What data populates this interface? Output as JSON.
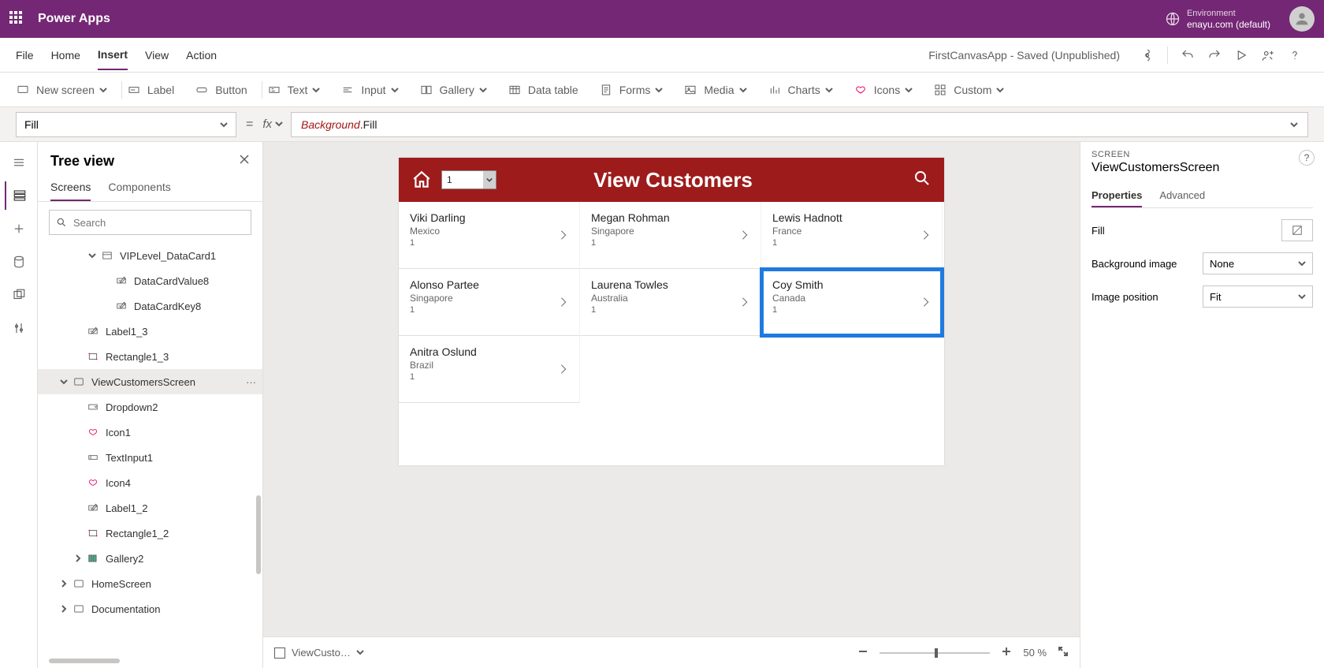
{
  "topbar": {
    "brand": "Power Apps",
    "env_label": "Environment",
    "env_value": "enayu.com (default)"
  },
  "menu": {
    "items": [
      "File",
      "Home",
      "Insert",
      "View",
      "Action"
    ],
    "active": "Insert",
    "app_status": "FirstCanvasApp - Saved (Unpublished)"
  },
  "ribbon": {
    "items": [
      {
        "label": "New screen",
        "icon": "screen-icon",
        "chev": true
      },
      {
        "label": "Label",
        "icon": "label-icon"
      },
      {
        "label": "Button",
        "icon": "button-icon"
      },
      {
        "label": "Text",
        "icon": "text-icon",
        "chev": true
      },
      {
        "label": "Input",
        "icon": "input-icon",
        "chev": true
      },
      {
        "label": "Gallery",
        "icon": "gallery-icon",
        "chev": true
      },
      {
        "label": "Data table",
        "icon": "datatable-icon"
      },
      {
        "label": "Forms",
        "icon": "forms-icon",
        "chev": true
      },
      {
        "label": "Media",
        "icon": "media-icon",
        "chev": true
      },
      {
        "label": "Charts",
        "icon": "charts-icon",
        "chev": true
      },
      {
        "label": "Icons",
        "icon": "icons-icon",
        "chev": true
      },
      {
        "label": "Custom",
        "icon": "custom-icon",
        "chev": true
      }
    ]
  },
  "formulabar": {
    "prop": "Fill",
    "formula_tok1": "Background",
    "formula_tok2": ".Fill"
  },
  "treepanel": {
    "title": "Tree view",
    "tabs": [
      "Screens",
      "Components"
    ],
    "active_tab": "Screens",
    "search_placeholder": "Search",
    "nodes": [
      {
        "depth": 3,
        "label": "VIPLevel_DataCard1",
        "icon": "datacard-icon",
        "chev": "down"
      },
      {
        "depth": 4,
        "label": "DataCardValue8",
        "icon": "label-icon"
      },
      {
        "depth": 4,
        "label": "DataCardKey8",
        "icon": "label-icon"
      },
      {
        "depth": 2,
        "label": "Label1_3",
        "icon": "label-icon"
      },
      {
        "depth": 2,
        "label": "Rectangle1_3",
        "icon": "rect-icon"
      },
      {
        "depth": 1,
        "label": "ViewCustomersScreen",
        "icon": "screen-icon",
        "chev": "down",
        "selected": true,
        "dots": true
      },
      {
        "depth": 2,
        "label": "Dropdown2",
        "icon": "dropdown-icon"
      },
      {
        "depth": 2,
        "label": "Icon1",
        "icon": "hearts-icon"
      },
      {
        "depth": 2,
        "label": "TextInput1",
        "icon": "textinput-icon"
      },
      {
        "depth": 2,
        "label": "Icon4",
        "icon": "hearts-icon"
      },
      {
        "depth": 2,
        "label": "Label1_2",
        "icon": "label-icon"
      },
      {
        "depth": 2,
        "label": "Rectangle1_2",
        "icon": "rect-icon"
      },
      {
        "depth": 2,
        "label": "Gallery2",
        "icon": "gallery2-icon",
        "chev": "right"
      },
      {
        "depth": 1,
        "label": "HomeScreen",
        "icon": "screen-icon",
        "chev": "right"
      },
      {
        "depth": 1,
        "label": "Documentation",
        "icon": "screen-icon",
        "chev": "right"
      }
    ]
  },
  "canvas": {
    "header": {
      "dropdown_value": "1",
      "title": "View Customers"
    },
    "gallery": [
      {
        "name": "Viki  Darling",
        "country": "Mexico",
        "val": "1"
      },
      {
        "name": "Megan  Rohman",
        "country": "Singapore",
        "val": "1"
      },
      {
        "name": "Lewis  Hadnott",
        "country": "France",
        "val": "1"
      },
      {
        "name": "Alonso  Partee",
        "country": "Singapore",
        "val": "1"
      },
      {
        "name": "Laurena  Towles",
        "country": "Australia",
        "val": "1"
      },
      {
        "name": "Coy  Smith",
        "country": "Canada",
        "val": "1",
        "selected": true
      },
      {
        "name": "Anitra  Oslund",
        "country": "Brazil",
        "val": "1"
      }
    ],
    "breadcrumb": "ViewCusto…",
    "zoom_value": "50",
    "zoom_suffix": "%"
  },
  "proppanel": {
    "label": "SCREEN",
    "name": "ViewCustomersScreen",
    "tabs": [
      "Properties",
      "Advanced"
    ],
    "active_tab": "Properties",
    "rows": {
      "fill_label": "Fill",
      "bg_label": "Background image",
      "bg_value": "None",
      "imgpos_label": "Image position",
      "imgpos_value": "Fit"
    }
  }
}
